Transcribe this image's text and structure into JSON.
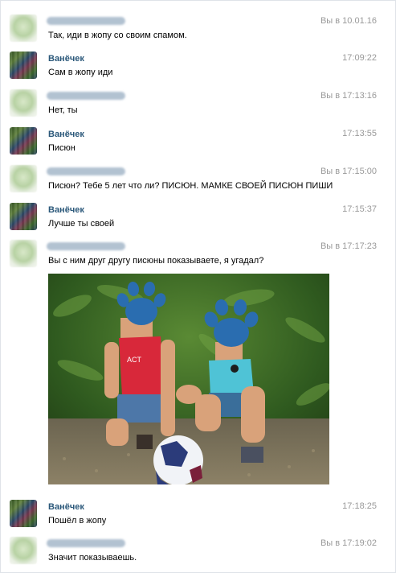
{
  "messages": [
    {
      "sender": "",
      "sender_hidden": true,
      "time": "Вы в 10.01.16",
      "text": "Так, иди в жопу со своим спамом."
    },
    {
      "sender": "Ванёчек",
      "sender_hidden": false,
      "time": "17:09:22",
      "text": "Сам в жопу иди"
    },
    {
      "sender": "",
      "sender_hidden": true,
      "time": "Вы в 17:13:16",
      "text": "Нет, ты"
    },
    {
      "sender": "Ванёчек",
      "sender_hidden": false,
      "time": "17:13:55",
      "text": "Писюн"
    },
    {
      "sender": "",
      "sender_hidden": true,
      "time": "Вы в 17:15:00",
      "text": "Писюн? Тебе 5 лет что ли? ПИСЮН. МАМКЕ СВОЕЙ ПИСЮН ПИШИ"
    },
    {
      "sender": "Ванёчек",
      "sender_hidden": false,
      "time": "17:15:37",
      "text": "Лучше ты своей"
    },
    {
      "sender": "",
      "sender_hidden": true,
      "time": "Вы в 17:17:23",
      "text": "Вы с ним друг другу писюны показываете, я угадал?"
    },
    {
      "sender": "Ванёчек",
      "sender_hidden": false,
      "time": "17:18:25",
      "text": "Пошёл в жопу"
    },
    {
      "sender": "",
      "sender_hidden": true,
      "time": "Вы в 17:19:02",
      "text": "Значит показываешь."
    }
  ],
  "colors": {
    "sender_name": "#2b587a",
    "timestamp": "#999999",
    "paw_censor": "#2a6db0"
  }
}
